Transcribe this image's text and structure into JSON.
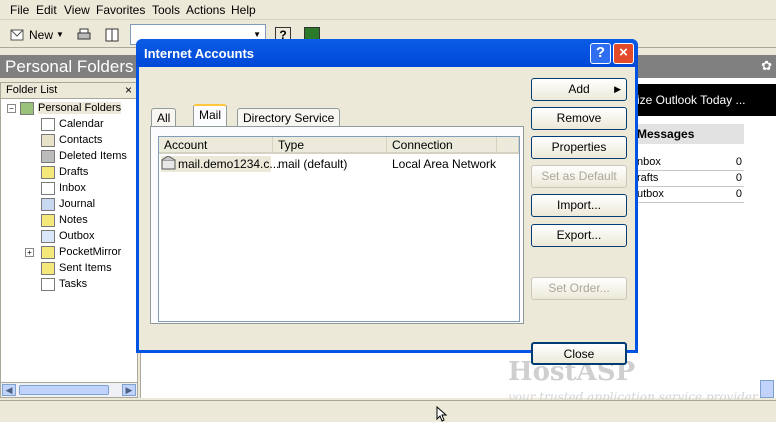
{
  "menu": {
    "items": [
      "File",
      "Edit",
      "View",
      "Favorites",
      "Tools",
      "Actions",
      "Help"
    ]
  },
  "toolbar": {
    "new_label": "New"
  },
  "folder_pane": {
    "header": "Personal Folders",
    "list_title": "Folder List",
    "close_glyph": "×",
    "root": "Personal Folders",
    "folders": [
      "Calendar",
      "Contacts",
      "Deleted Items",
      "Drafts",
      "Inbox",
      "Journal",
      "Notes",
      "Outbox",
      "PocketMirror",
      "Sent Items",
      "Tasks"
    ]
  },
  "right_pane": {
    "outlook_today_text": "ize Outlook Today ...",
    "messages_title": "Messages",
    "rows": [
      {
        "name": "nbox",
        "count": "0"
      },
      {
        "name": "rafts",
        "count": "0"
      },
      {
        "name": "utbox",
        "count": "0"
      }
    ]
  },
  "watermark": {
    "title": "HostASP",
    "subtitle": "your trusted application service provider"
  },
  "dialog": {
    "title": "Internet Accounts",
    "help_glyph": "?",
    "close_glyph": "×",
    "tabs": [
      "All",
      "Mail",
      "Directory Service"
    ],
    "active_tab": "Mail",
    "columns": [
      "Account",
      "Type",
      "Connection"
    ],
    "accounts": [
      {
        "account": "mail.demo1234.c...",
        "type": "mail (default)",
        "connection": "Local Area Network"
      }
    ],
    "buttons": {
      "add": "Add",
      "remove": "Remove",
      "properties": "Properties",
      "set_default": "Set as Default",
      "import": "Import...",
      "export": "Export...",
      "set_order": "Set Order...",
      "close": "Close"
    }
  },
  "colors": {
    "dialog_frame": "#0054e3",
    "pane_header": "#808080",
    "face": "#ece9d8"
  }
}
